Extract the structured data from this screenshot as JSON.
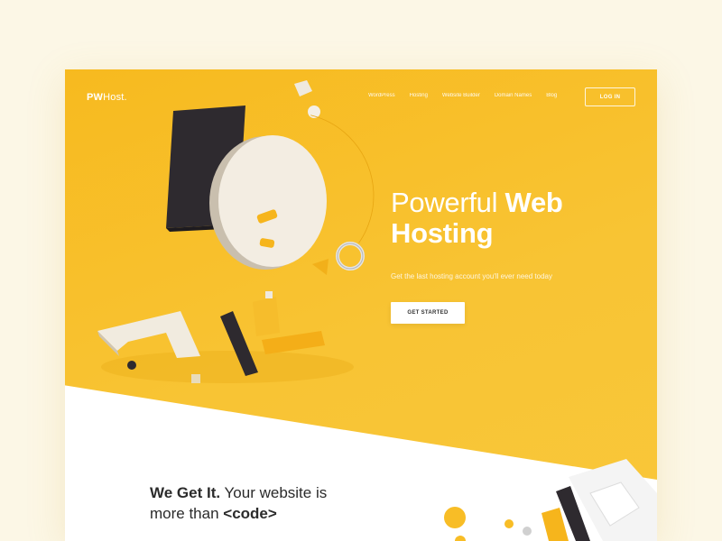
{
  "brand": {
    "logo_bold": "PW",
    "logo_rest": "Host."
  },
  "nav": {
    "items": [
      "WordPress",
      "Hosting",
      "Website Builder",
      "Domain Names",
      "Blog"
    ],
    "login_label": "LOG IN"
  },
  "hero": {
    "headline_light": "Powerful",
    "headline_bold_1": "Web",
    "headline_bold_2": "Hosting",
    "subline": "Get the last hosting account you'll ever need today",
    "cta_label": "GET STARTED"
  },
  "section": {
    "title_bold": "We Get It.",
    "title_rest": "Your website is",
    "title_line2": "more than",
    "title_code": "<code>"
  },
  "colors": {
    "page_bg": "#fcf7e6",
    "accent_yellow": "#f8c132",
    "dark": "#2b2b2b",
    "white": "#ffffff"
  }
}
